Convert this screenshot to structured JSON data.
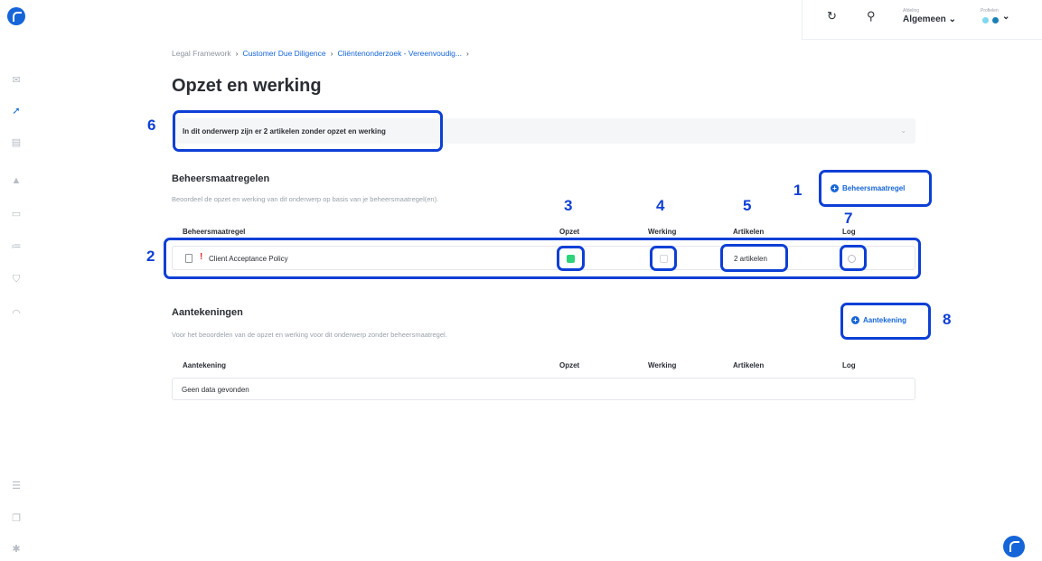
{
  "sidebar": {
    "icons": [
      "logo-icon",
      "mail-icon",
      "gavel-icon",
      "files-icon",
      "warning-icon",
      "calendar-icon",
      "checklist-icon",
      "shield-icon",
      "rss-icon",
      "document-icon",
      "copy-icon",
      "gear-icon"
    ]
  },
  "topbar": {
    "afdeling_label": "Afdeling",
    "afdeling_value": "Algemeen",
    "profielen_label": "Profielen",
    "chevron": "⌄"
  },
  "breadcrumb": {
    "items": [
      "Legal Framework",
      "Customer Due Diligence",
      "Cliëntenonderzoek - Vereenvoudig..."
    ],
    "separator": "›"
  },
  "page_title": "Opzet en werking",
  "info_bar": {
    "text": "In dit onderwerp zijn er 2 artikelen zonder opzet en werking"
  },
  "beheersmaatregelen": {
    "title": "Beheersmaatregelen",
    "subtitle": "Beoordeel de opzet en werking van dit onderwerp op basis van je beheersmaatregel(en).",
    "add_button": "Beheersmaatregel",
    "columns": [
      "Beheersmaatregel",
      "Opzet",
      "Werking",
      "Artikelen",
      "Log"
    ],
    "rows": [
      {
        "name": "Client Acceptance Policy",
        "priority": "!",
        "artikelen": "2 artikelen"
      }
    ]
  },
  "aantekeningen": {
    "title": "Aantekeningen",
    "subtitle": "Voor het beoordelen van de opzet en werking voor dit onderwerp zonder beheersmaatregel.",
    "add_button": "Aantekening",
    "columns": [
      "Aantekening",
      "Opzet",
      "Werking",
      "Artikelen",
      "Log"
    ],
    "empty_text": "Geen data gevonden"
  },
  "annotations": [
    "1",
    "2",
    "3",
    "4",
    "5",
    "6",
    "7",
    "8"
  ],
  "colors": {
    "accent": "#1565d8",
    "annotation": "#0d3fd6",
    "status_green": "#2ed37a",
    "priority_red": "#e02424"
  }
}
